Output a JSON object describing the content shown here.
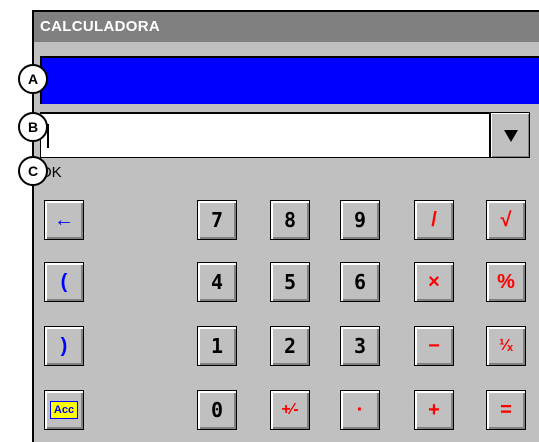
{
  "window": {
    "title": "CALCULADORA"
  },
  "display_a": {
    "value": ""
  },
  "input_b": {
    "value": ""
  },
  "status_c": {
    "text": "OK"
  },
  "callouts": {
    "a": "A",
    "b": "B",
    "c": "C"
  },
  "colors": {
    "display_bg": "#0000ff",
    "titlebar_bg": "#808080",
    "face": "#c0c0c0",
    "red": "#ff0000",
    "blue": "#0000ff"
  },
  "keys": {
    "back": "←",
    "open_paren": "(",
    "close_paren": ")",
    "acc": "Acc",
    "d7": "7",
    "d8": "8",
    "d9": "9",
    "d4": "4",
    "d5": "5",
    "d6": "6",
    "d1": "1",
    "d2": "2",
    "d3": "3",
    "d0": "0",
    "plusminus": "+⁄-",
    "dot": "·",
    "divide": "/",
    "sqrt": "√",
    "multiply": "×",
    "percent": "%",
    "minus": "−",
    "reciprocal": "¹⁄ₓ",
    "plus": "+",
    "equals": "="
  }
}
